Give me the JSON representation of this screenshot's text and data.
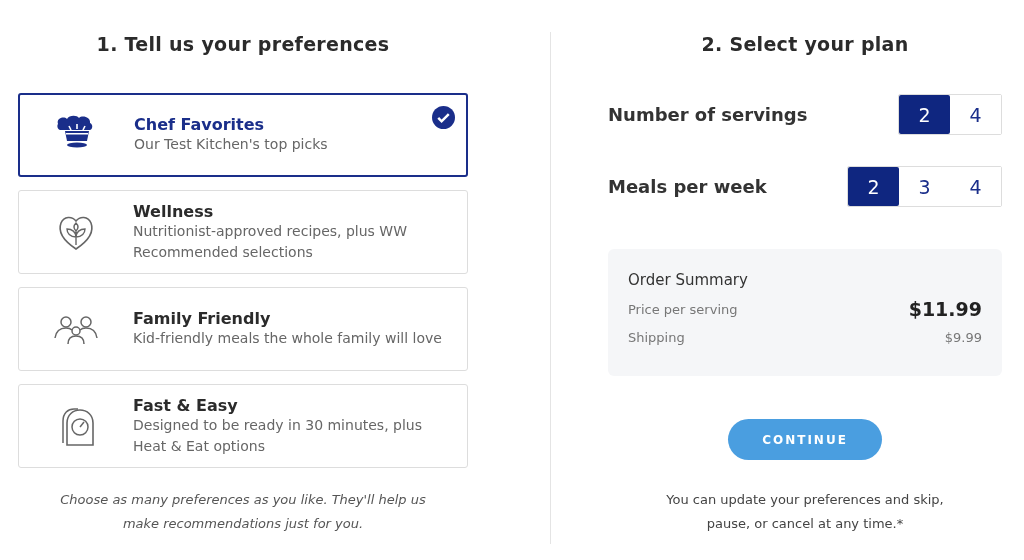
{
  "preferences_section": {
    "heading": "1. Tell us your preferences",
    "options": [
      {
        "title": "Chef Favorites",
        "description": "Our Test Kitchen's top picks",
        "selected": true
      },
      {
        "title": "Wellness",
        "description": "Nutritionist-approved recipes, plus WW Recommended selections",
        "selected": false
      },
      {
        "title": "Family Friendly",
        "description": "Kid-friendly meals the whole family will love",
        "selected": false
      },
      {
        "title": "Fast & Easy",
        "description": "Designed to be ready in 30 minutes, plus Heat & Eat options",
        "selected": false
      }
    ],
    "note": "Choose as many preferences as you like. They'll help us make recommendations just for you."
  },
  "plan_section": {
    "heading": "2. Select your plan",
    "settings": [
      {
        "label": "Number of servings",
        "choices": [
          {
            "label": "2",
            "selected": true
          },
          {
            "label": "4",
            "selected": false
          }
        ]
      },
      {
        "label": "Meals per week",
        "choices": [
          {
            "label": "2",
            "selected": true
          },
          {
            "label": "3",
            "selected": false
          },
          {
            "label": "4",
            "selected": false
          }
        ]
      }
    ],
    "order_summary": {
      "title": "Order Summary",
      "rows": [
        {
          "kind": "price",
          "label": "Price per serving",
          "value": "$11.99"
        },
        {
          "kind": "shipping",
          "label": "Shipping",
          "value": "$9.99"
        }
      ]
    },
    "continue_button": "CONTINUE",
    "note": "You can update your preferences and skip, pause, or cancel at any time.*"
  }
}
